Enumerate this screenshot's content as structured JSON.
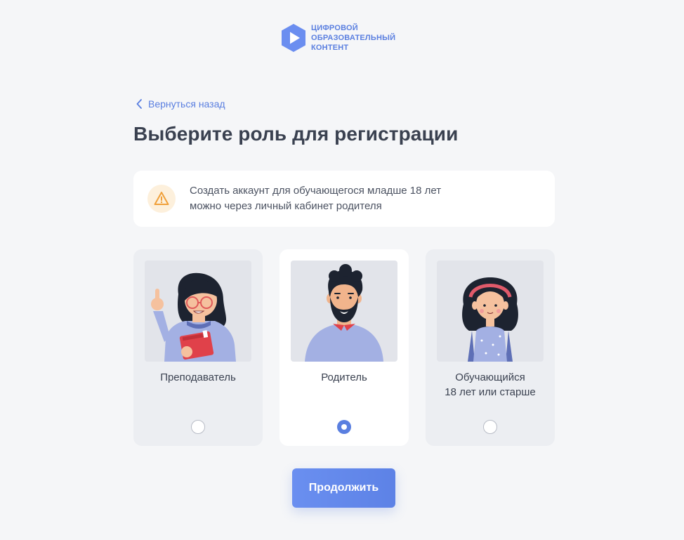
{
  "brand": {
    "line1": "ЦИФРОВОЙ",
    "line2": "ОБРАЗОВАТЕЛЬНЫЙ",
    "line3": "КОНТЕНТ",
    "color": "#5a7fe0"
  },
  "back_link": {
    "label": "Вернуться назад",
    "icon": "chevron-left-icon"
  },
  "title": "Выберите роль для регистрации",
  "notice": {
    "icon": "warning-icon",
    "line1": "Создать аккаунт для обучающегося младше 18 лет",
    "line2": "можно через личный кабинет родителя",
    "icon_color": "#f0a03a"
  },
  "roles": [
    {
      "line1": "Преподаватель",
      "line2": "",
      "selected": false,
      "illustration": "teacher-illustration"
    },
    {
      "line1": "Родитель",
      "line2": "",
      "selected": true,
      "illustration": "parent-illustration"
    },
    {
      "line1": "Обучающийся",
      "line2": "18 лет или старше",
      "selected": false,
      "illustration": "student-illustration"
    }
  ],
  "continue_button": {
    "label": "Продолжить",
    "color": "#5d82e6"
  }
}
